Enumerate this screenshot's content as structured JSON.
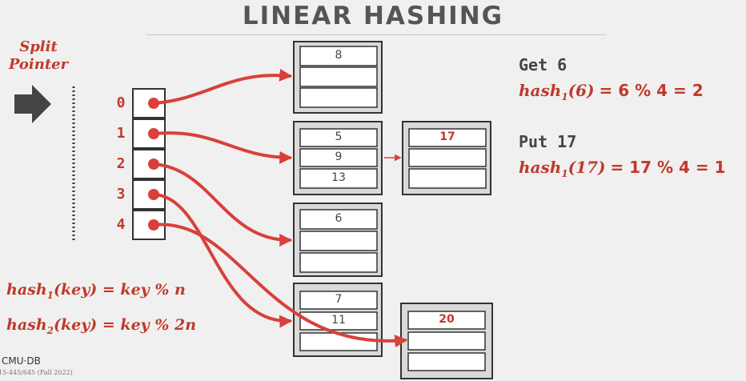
{
  "slide": {
    "title": "LINEAR HASHING",
    "split_label_line1": "Split",
    "split_label_line2": "Pointer",
    "slot_indices": [
      "0",
      "1",
      "2",
      "3",
      "4"
    ],
    "logo": "CMU·DB",
    "course": "15-445/645 (Fall 2022)"
  },
  "buckets": {
    "b0": [
      "8",
      "",
      ""
    ],
    "b1": [
      "5",
      "9",
      "13"
    ],
    "b1_overflow": [
      "17",
      "",
      ""
    ],
    "b2": [
      "6",
      "",
      ""
    ],
    "b3": [
      "7",
      "11",
      ""
    ],
    "b3_overflow": [
      "20",
      "",
      ""
    ]
  },
  "operations": {
    "get": {
      "label": "Get 6",
      "fn": "hash",
      "sub": "1",
      "arg": "(6)",
      "result": "=  6 % 4 = 2"
    },
    "put": {
      "label": "Put 17",
      "fn": "hash",
      "sub": "1",
      "arg": "(17)",
      "result": "=  17 % 4 = 1"
    }
  },
  "formulas": {
    "h1": {
      "fn": "hash",
      "sub": "1",
      "rest": "(key) = key % n"
    },
    "h2": {
      "fn": "hash",
      "sub": "2",
      "rest": "(key) = key % 2n"
    }
  },
  "colors": {
    "accent": "#c0392b",
    "bucket_outer": "#d9d9d9",
    "bucket_border": "#333333",
    "background": "#f0f0f0"
  }
}
